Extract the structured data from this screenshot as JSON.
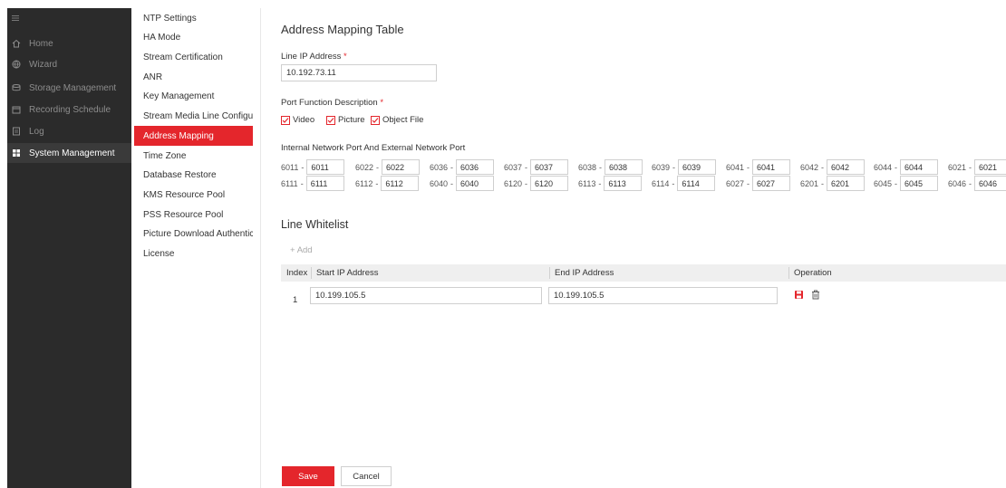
{
  "sidebar": {
    "items": [
      {
        "label": "Home",
        "icon": "home-icon"
      },
      {
        "label": "Wizard",
        "icon": "globe-icon"
      },
      {
        "label": "Storage Management",
        "icon": "storage-icon"
      },
      {
        "label": "Recording Schedule",
        "icon": "calendar-icon"
      },
      {
        "label": "Log",
        "icon": "log-icon"
      },
      {
        "label": "System Management",
        "icon": "grid-icon",
        "active": true
      }
    ]
  },
  "submenu": {
    "items": [
      "NTP Settings",
      "HA Mode",
      "Stream Certification",
      "ANR",
      "Key Management",
      "Stream Media Line Configura...",
      "Address Mapping",
      "Time Zone",
      "Database Restore",
      "KMS Resource Pool",
      "PSS Resource Pool",
      "Picture Download Authentica...",
      "License"
    ],
    "active_index": 6
  },
  "main": {
    "title": "Address Mapping Table",
    "line_ip": {
      "label": "Line IP Address",
      "required_mark": "*",
      "value": "10.192.73.11"
    },
    "port_function": {
      "label": "Port Function Description",
      "required_mark": "*",
      "options": [
        {
          "label": "Video",
          "checked": true
        },
        {
          "label": "Picture",
          "checked": true
        },
        {
          "label": "Object File",
          "checked": true
        }
      ]
    },
    "port_mapping": {
      "label": "Internal Network Port And External Network Port",
      "rows": [
        [
          [
            "6011",
            "6011"
          ],
          [
            "6022",
            "6022"
          ],
          [
            "6036",
            "6036"
          ],
          [
            "6037",
            "6037"
          ],
          [
            "6038",
            "6038"
          ],
          [
            "6039",
            "6039"
          ],
          [
            "6041",
            "6041"
          ],
          [
            "6042",
            "6042"
          ],
          [
            "6044",
            "6044"
          ],
          [
            "6021",
            "6021"
          ]
        ],
        [
          [
            "6111",
            "6111"
          ],
          [
            "6112",
            "6112"
          ],
          [
            "6040",
            "6040"
          ],
          [
            "6120",
            "6120"
          ],
          [
            "6113",
            "6113"
          ],
          [
            "6114",
            "6114"
          ],
          [
            "6027",
            "6027"
          ],
          [
            "6201",
            "6201"
          ],
          [
            "6045",
            "6045"
          ],
          [
            "6046",
            "6046"
          ]
        ]
      ]
    },
    "whitelist": {
      "title": "Line Whitelist",
      "add_label": "Add",
      "columns": [
        "Index",
        "Start IP Address",
        "End IP Address",
        "Operation"
      ],
      "rows": [
        {
          "index": "1",
          "start": "10.199.105.5",
          "end": "10.199.105.5"
        }
      ]
    },
    "save_label": "Save",
    "cancel_label": "Cancel"
  },
  "colors": {
    "accent": "#e4262c",
    "sidebar_bg": "#2b2b2b"
  }
}
